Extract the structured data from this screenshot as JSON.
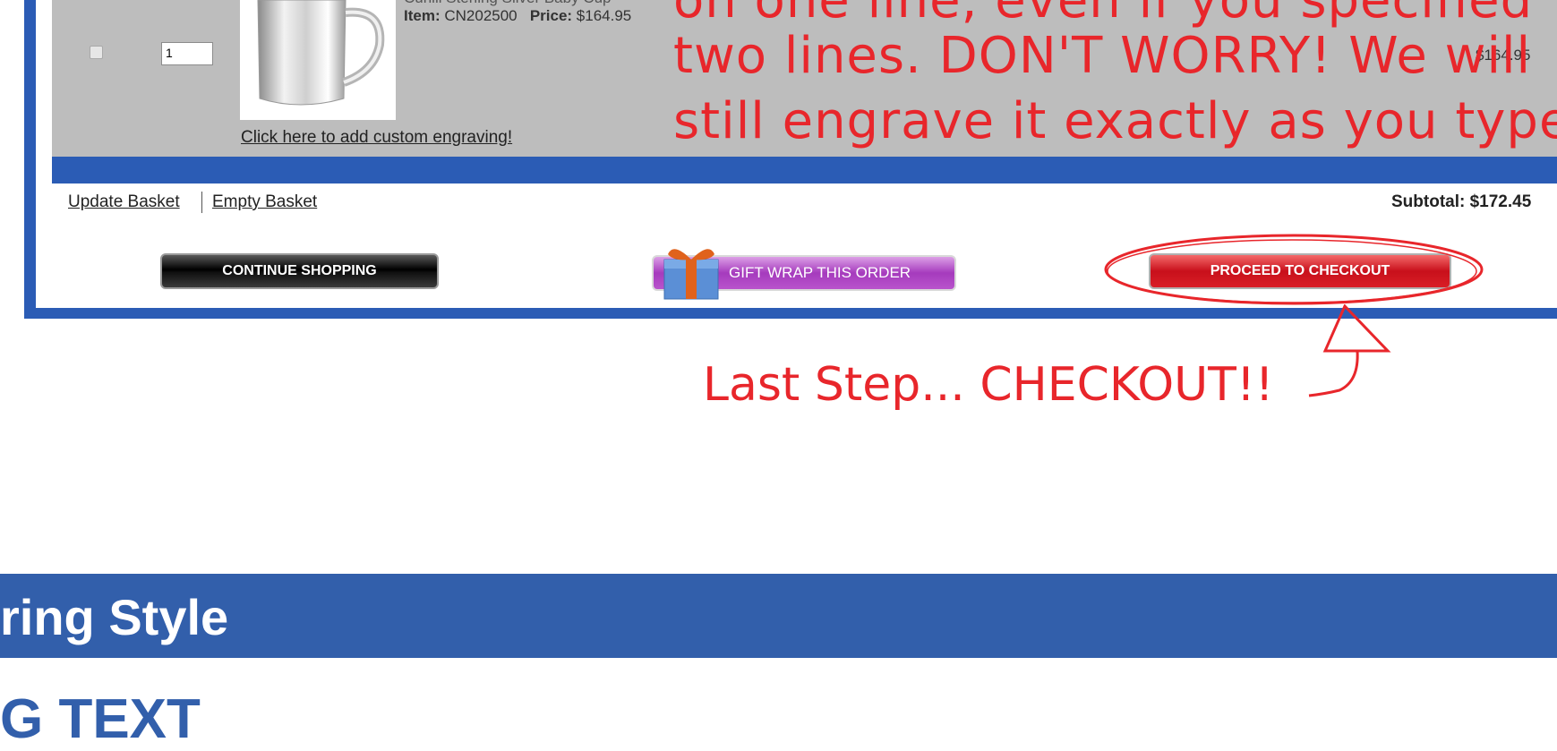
{
  "basket": {
    "item": {
      "name_cut": "Cunill Sterling Silver Baby Cup",
      "item_label": "Item:",
      "item_code": "CN202500",
      "price_label": "Price:",
      "price": "$164.95",
      "quantity": "1",
      "line_total": "$164.95",
      "engrave_link": "Click here to add custom engraving!"
    },
    "update_link": "Update Basket",
    "empty_link": "Empty Basket",
    "subtotal": "Subtotal: $172.45"
  },
  "buttons": {
    "continue": "CONTINUE SHOPPING",
    "gift_wrap": "GIFT WRAP THIS ORDER",
    "checkout": "PROCEED TO CHECKOUT"
  },
  "annotation": {
    "line_top": "on one line, even if you specified",
    "line_2": "two lines. DON'T WORRY! We will",
    "line_3": "still engrave it exactly as you typed",
    "caption": "Last Step... CHECKOUT!!",
    "color": "#e8262b"
  },
  "section": {
    "title": "ring Style",
    "sub": "G TEXT",
    "color": "#325fab"
  }
}
